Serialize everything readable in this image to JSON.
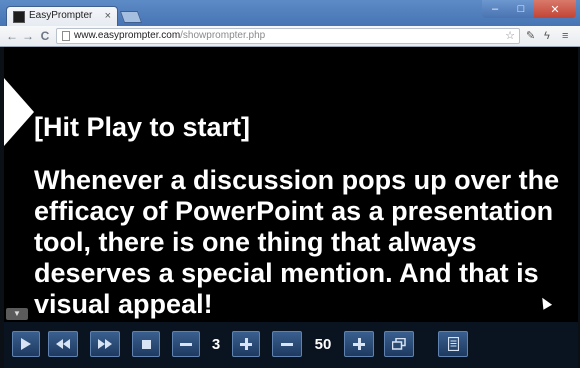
{
  "browser": {
    "tab": {
      "title": "EasyPrompter",
      "close_glyph": "×"
    },
    "window_controls": {
      "minimize": "–",
      "maximize": "□",
      "close": "✕"
    },
    "address": {
      "host": "www.easyprompter.com",
      "path": "/showprompter.php"
    },
    "nav": {
      "back": "←",
      "forward": "→",
      "reload": "C"
    },
    "toolbar_icons": [
      "star-icon",
      "tools-icon",
      "extension-icon",
      "menu-icon"
    ]
  },
  "prompter": {
    "lines": [
      "[Hit Play to start]",
      "Whenever a discussion pops up over the efficacy of PowerPoint as a presentation tool, there is one thing that always deserves a special mention. And that is visual appeal!"
    ]
  },
  "controls": {
    "font_size": "3",
    "speed": "50",
    "icons": [
      "play-icon",
      "rewind-icon",
      "fast-forward-icon",
      "stop-icon",
      "minus-icon",
      "plus-icon",
      "minus-icon",
      "plus-icon",
      "window-icon",
      "document-icon"
    ]
  },
  "colors": {
    "background": "#000000",
    "text": "#ffffff",
    "control_button": "#2d4f7c"
  }
}
